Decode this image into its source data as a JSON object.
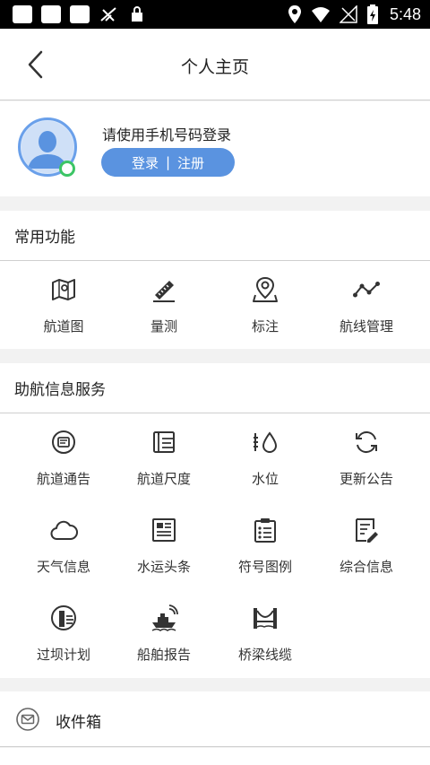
{
  "status_bar": {
    "time": "5:48"
  },
  "nav": {
    "title": "个人主页"
  },
  "profile": {
    "login_prompt": "请使用手机号码登录",
    "login_label": "登录",
    "separator": "|",
    "register_label": "注册"
  },
  "sections": {
    "common": {
      "title": "常用功能",
      "items": [
        {
          "label": "航道图",
          "icon": "channel-map-icon"
        },
        {
          "label": "量测",
          "icon": "ruler-icon"
        },
        {
          "label": "标注",
          "icon": "map-pin-icon"
        },
        {
          "label": "航线管理",
          "icon": "route-icon"
        }
      ]
    },
    "navinfo": {
      "title": "助航信息服务",
      "items": [
        {
          "label": "航道通告",
          "icon": "notice-icon"
        },
        {
          "label": "航道尺度",
          "icon": "scale-icon"
        },
        {
          "label": "水位",
          "icon": "water-level-icon"
        },
        {
          "label": "更新公告",
          "icon": "refresh-icon"
        },
        {
          "label": "天气信息",
          "icon": "cloud-icon"
        },
        {
          "label": "水运头条",
          "icon": "news-icon"
        },
        {
          "label": "符号图例",
          "icon": "legend-icon"
        },
        {
          "label": "综合信息",
          "icon": "info-doc-icon"
        },
        {
          "label": "过坝计划",
          "icon": "dam-icon"
        },
        {
          "label": "船舶报告",
          "icon": "ship-icon"
        },
        {
          "label": "桥梁线缆",
          "icon": "bridge-icon"
        }
      ]
    }
  },
  "inbox": {
    "label": "收件箱"
  },
  "colors": {
    "accent": "#5a93e0",
    "online": "#3cc565"
  }
}
